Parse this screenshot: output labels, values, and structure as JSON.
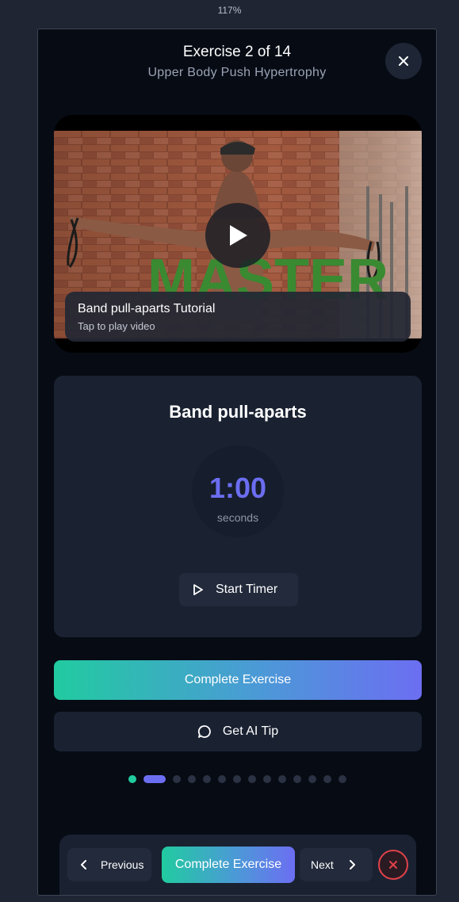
{
  "zoom_level": "117%",
  "header": {
    "title": "Exercise 2 of 14",
    "subtitle": "Upper Body Push Hypertrophy",
    "close_icon": "close-icon"
  },
  "video": {
    "overlay_text": "MASTER",
    "caption_title": "Band pull-aparts Tutorial",
    "caption_subtitle": "Tap to play video",
    "play_icon": "play-icon"
  },
  "exercise": {
    "name": "Band pull-aparts",
    "timer_value": "1:00",
    "timer_unit": "seconds",
    "start_label": "Start Timer"
  },
  "actions": {
    "complete_label": "Complete Exercise",
    "tip_label": "Get AI Tip"
  },
  "progress": {
    "total": 14,
    "current": 2
  },
  "bottom_nav": {
    "previous_label": "Previous",
    "complete_label": "Complete Exercise",
    "next_label": "Next"
  },
  "colors": {
    "accent_teal": "#21cba0",
    "accent_indigo": "#6c6ef2",
    "danger": "#e0424a",
    "surface": "#1a2232",
    "background": "#070b14"
  }
}
